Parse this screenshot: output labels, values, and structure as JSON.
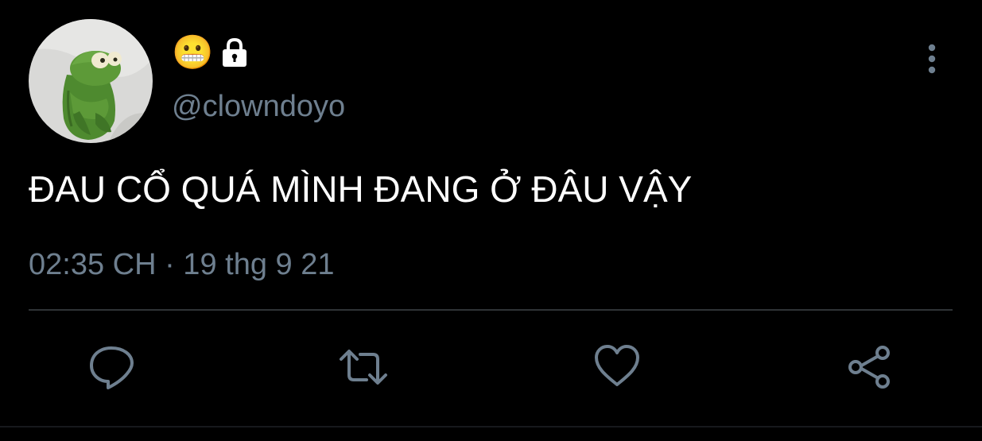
{
  "profile": {
    "name_emoji": "😬",
    "handle": "@clowndoyo"
  },
  "icons": {
    "avatar": "kermit-frog-avatar",
    "lock": "lock-icon",
    "more": "more-vertical-icon",
    "reply": "reply-icon",
    "retweet": "retweet-icon",
    "like": "heart-icon",
    "share": "share-icon"
  },
  "tweet": {
    "text": "ĐAU CỔ QUÁ MÌNH ĐANG Ở ĐÂU VẬY",
    "timestamp": "02:35 CH · 19 thg 9 21"
  },
  "colors": {
    "background": "#000000",
    "text_primary": "#ffffff",
    "text_secondary": "#6e7f8f",
    "divider": "#2f3336",
    "icon": "#6e7f8f"
  }
}
